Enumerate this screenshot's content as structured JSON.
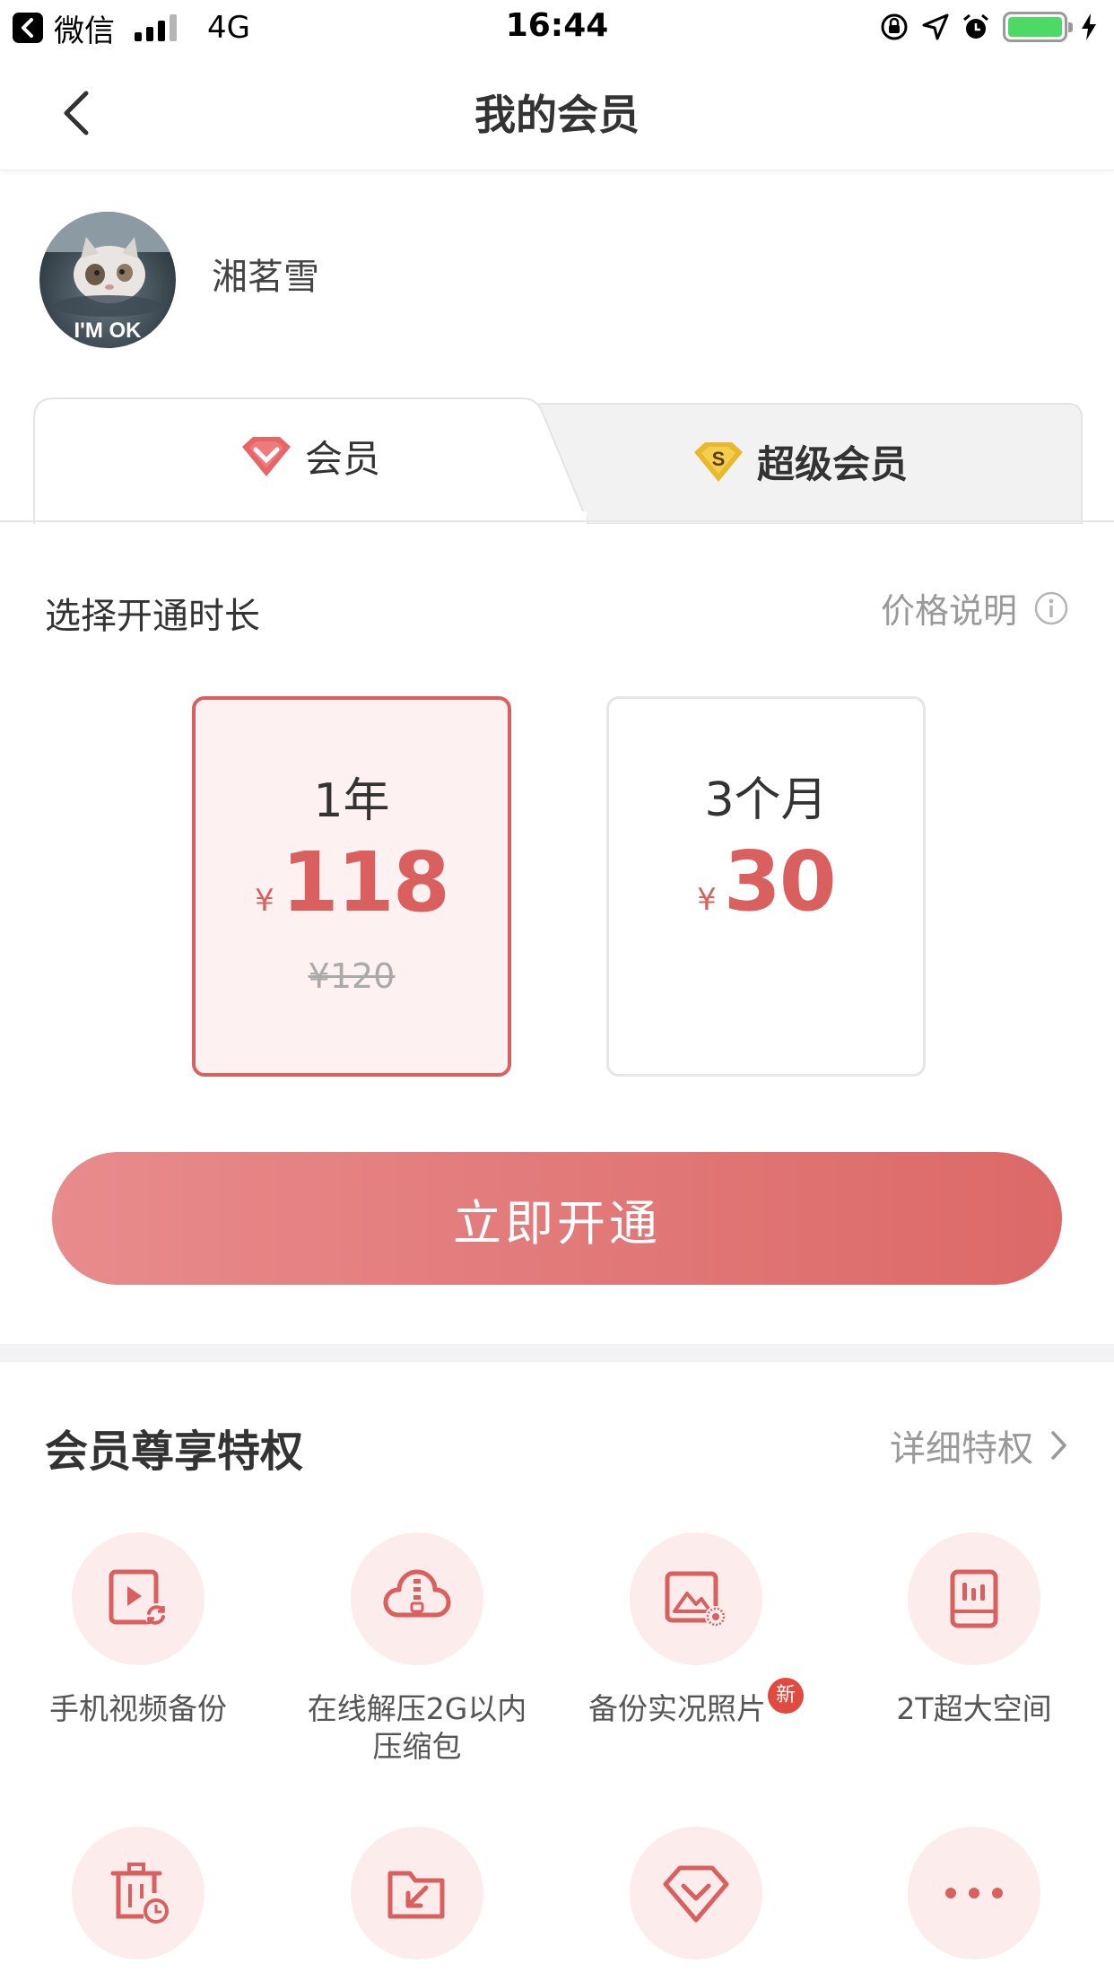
{
  "status_bar": {
    "app": "微信",
    "network": "4G",
    "time": "16:44"
  },
  "nav": {
    "title": "我的会员"
  },
  "profile": {
    "username": "湘茗雪",
    "avatar_text": "I'M OK"
  },
  "tabs": [
    {
      "label": "会员",
      "icon": "heart-diamond-icon",
      "selected": true
    },
    {
      "label": "超级会员",
      "icon": "super-s-diamond-icon",
      "selected": false
    }
  ],
  "duration": {
    "label": "选择开通时长",
    "price_info": "价格说明"
  },
  "plans": [
    {
      "name": "1年",
      "currency": "¥",
      "price": "118",
      "original": "¥120",
      "selected": true
    },
    {
      "name": "3个月",
      "currency": "¥",
      "price": "30",
      "original": "",
      "selected": false
    }
  ],
  "cta": {
    "label": "立即开通"
  },
  "privileges": {
    "title": "会员尊享特权",
    "detail": "详细特权",
    "items": [
      {
        "label": "手机视频备份",
        "icon": "video-backup-icon"
      },
      {
        "label": "在线解压2G以内压缩包",
        "icon": "cloud-unzip-icon"
      },
      {
        "label": "备份实况照片",
        "icon": "live-photo-icon",
        "badge": "新"
      },
      {
        "label": "2T超大空间",
        "icon": "storage-icon"
      },
      {
        "label": "",
        "icon": "recycle-bin-icon"
      },
      {
        "label": "",
        "icon": "folder-import-icon"
      },
      {
        "label": "",
        "icon": "vip-diamond-icon"
      },
      {
        "label": "",
        "icon": "more-icon"
      }
    ]
  },
  "colors": {
    "accent": "#d9605f",
    "accent_light": "#fcecec",
    "gold": "#e8b92c"
  }
}
